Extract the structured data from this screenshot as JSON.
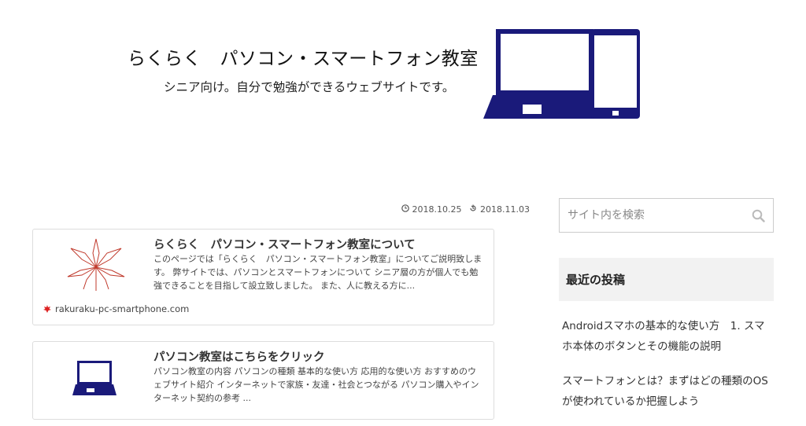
{
  "header": {
    "site_title": "らくらく　パソコン・スマートフォン教室",
    "tagline": "シニア向け。自分で勉強ができるウェブサイトです。",
    "logo_icons": [
      "laptop-icon",
      "smartphone-icon"
    ],
    "logo_color": "#1a1a7a"
  },
  "post": {
    "published_date": "2018.10.25",
    "updated_date": "2018.11.03"
  },
  "cards": [
    {
      "title": "らくらく　パソコン・スマートフォン教室について",
      "excerpt": "このページでは「らくらく　パソコン・スマートフォン教室」についてご説明致します。 弊サイトでは、パソコンとスマートフォンについて シニア層の方が個人でも勉強できることを目指して設立致しました。 また、人に教える方に...",
      "thumbnail_icon": "maple-leaf-icon",
      "site": "rakuraku-pc-smartphone.com"
    },
    {
      "title": "パソコン教室はこちらをクリック",
      "excerpt": "パソコン教室の内容 パソコンの種類 基本的な使い方 応用的な使い方 おすすめのウェブサイト紹介 インターネットで家族・友達・社会とつながる パソコン購入やインターネット契約の参考 ...",
      "thumbnail_icon": "laptop-icon"
    }
  ],
  "sidebar": {
    "search_placeholder": "サイト内を検索",
    "recent_title": "最近の投稿",
    "recent_posts": [
      "Androidスマホの基本的な使い方　1. スマホ本体のボタンとその機能の説明",
      "スマートフォンとは？まずはどの種類のOSが使われているか把握しよう"
    ]
  }
}
